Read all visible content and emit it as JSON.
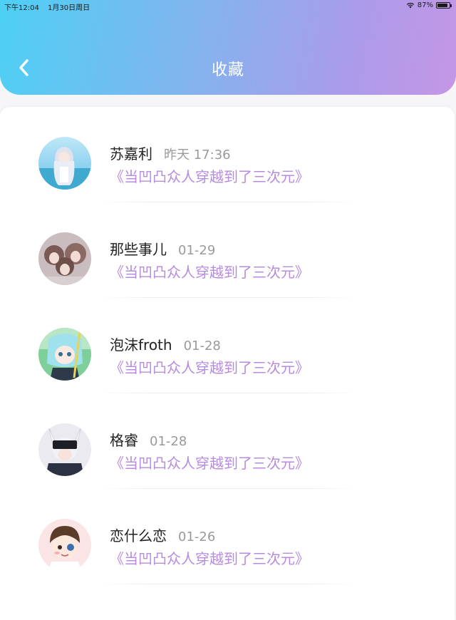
{
  "status_bar": {
    "time": "下午12:04",
    "date": "1月30日周日",
    "battery": "87%"
  },
  "header": {
    "title": "收藏",
    "back_icon": "chevron-left-icon"
  },
  "colors": {
    "accent_purple": "#b68be0",
    "gradient_start": "#4dd0f5",
    "gradient_end": "#c596e6"
  },
  "favorites": [
    {
      "name": "苏嘉利",
      "time": "昨天 17:36",
      "book": "《当凹凸众人穿越到了三次元》"
    },
    {
      "name": "那些事儿",
      "time": "01-29",
      "book": "《当凹凸众人穿越到了三次元》"
    },
    {
      "name": "泡沫froth",
      "time": "01-28",
      "book": "《当凹凸众人穿越到了三次元》"
    },
    {
      "name": "格睿",
      "time": "01-28",
      "book": "《当凹凸众人穿越到了三次元》"
    },
    {
      "name": "恋什么恋",
      "time": "01-26",
      "book": "《当凹凸众人穿越到了三次元》"
    }
  ]
}
